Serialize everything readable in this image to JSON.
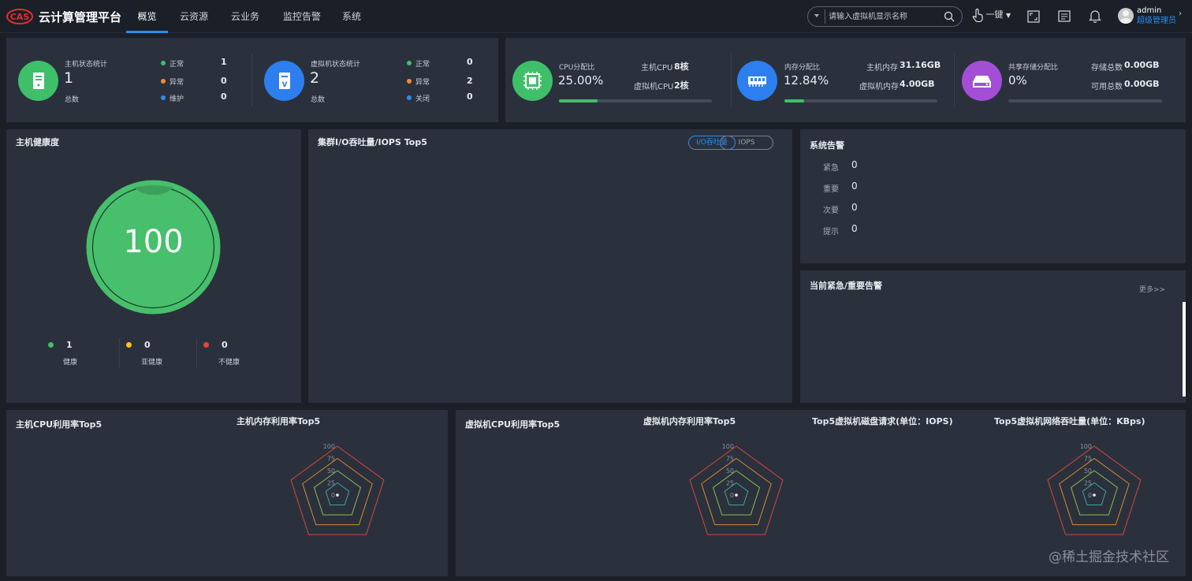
{
  "app": {
    "title": "云计算管理平台"
  },
  "nav": {
    "items": [
      "概览",
      "云资源",
      "云业务",
      "监控告警",
      "系统"
    ]
  },
  "search": {
    "placeholder": "请输入虚拟机显示名称"
  },
  "toolbar": {
    "onekey_label": "一键"
  },
  "user": {
    "name": "admin",
    "role": "超级管理员"
  },
  "host_stats": {
    "title": "主机状态统计",
    "total": "1",
    "total_label": "总数",
    "items": [
      {
        "label": "正常",
        "value": "1",
        "color": "#3fbf69"
      },
      {
        "label": "异常",
        "value": "0",
        "color": "#f08c3a"
      },
      {
        "label": "维护",
        "value": "0",
        "color": "#2d8cf0"
      }
    ]
  },
  "vm_stats": {
    "title": "虚拟机状态统计",
    "total": "2",
    "total_label": "总数",
    "items": [
      {
        "label": "正常",
        "value": "0",
        "color": "#3fbf69"
      },
      {
        "label": "异常",
        "value": "2",
        "color": "#f08c3a"
      },
      {
        "label": "关闭",
        "value": "0",
        "color": "#2d8cf0"
      }
    ]
  },
  "cpu": {
    "label": "CPU分配比",
    "percent": "25.00%",
    "ratio": 0.25,
    "host_label": "主机CPU",
    "host_value": "8核",
    "vm_label": "虚拟机CPU",
    "vm_value": "2核"
  },
  "memory": {
    "label": "内存分配比",
    "percent": "12.84%",
    "ratio": 0.1284,
    "host_label": "主机内存",
    "host_value": "31.16GB",
    "vm_label": "虚拟机内存",
    "vm_value": "4.00GB"
  },
  "storage": {
    "label": "共享存储分配比",
    "percent": "0%",
    "ratio": 0,
    "total_label": "存储总数",
    "total_value": "0.00GB",
    "avail_label": "可用总数",
    "avail_value": "0.00GB"
  },
  "health": {
    "title": "主机健康度",
    "score": "100",
    "legend": [
      {
        "label": "健康",
        "value": "1",
        "color": "#3fbf69"
      },
      {
        "label": "亚健康",
        "value": "0",
        "color": "#f5c518"
      },
      {
        "label": "不健康",
        "value": "0",
        "color": "#e6453c"
      }
    ]
  },
  "cluster_io": {
    "title": "集群I/O吞吐量/IOPS Top5",
    "tab_io": "I/O吞吐量",
    "tab_iops": "IOPS"
  },
  "alarms": {
    "title": "系统告警",
    "items": [
      {
        "label": "紧急",
        "value": "0"
      },
      {
        "label": "重要",
        "value": "0"
      },
      {
        "label": "次要",
        "value": "0"
      },
      {
        "label": "提示",
        "value": "0"
      }
    ]
  },
  "current_alarms": {
    "title": "当前紧急/重要告警",
    "more": "更多>>"
  },
  "bottom": {
    "host_cpu_title": "主机CPU利用率Top5",
    "host_mem_title": "主机内存利用率Top5",
    "vm_cpu_title": "虚拟机CPU利用率Top5",
    "vm_mem_title": "虚拟机内存利用率Top5",
    "vm_disk_title": "Top5虚拟机磁盘请求(单位：IOPS)",
    "vm_net_title": "Top5虚拟机网络吞吐量(单位：KBps)"
  },
  "chart_data": [
    {
      "type": "radar",
      "title": "主机内存利用率Top5",
      "ticks": [
        "100",
        "75",
        "50",
        "25",
        "0"
      ],
      "max": 100,
      "values": [
        0,
        0,
        0,
        0,
        0
      ]
    },
    {
      "type": "radar",
      "title": "虚拟机内存利用率Top5",
      "ticks": [
        "100",
        "75",
        "50",
        "25",
        "0"
      ],
      "max": 100,
      "values": [
        0,
        0,
        0,
        0,
        0
      ]
    },
    {
      "type": "radar",
      "title": "Top5虚拟机网络吞吐量(单位：KBps)",
      "ticks": [
        "100",
        "75",
        "50",
        "25",
        "0"
      ],
      "max": 100,
      "values": [
        0,
        0,
        0,
        0,
        0
      ]
    }
  ],
  "watermark": "@稀土掘金技术社区"
}
